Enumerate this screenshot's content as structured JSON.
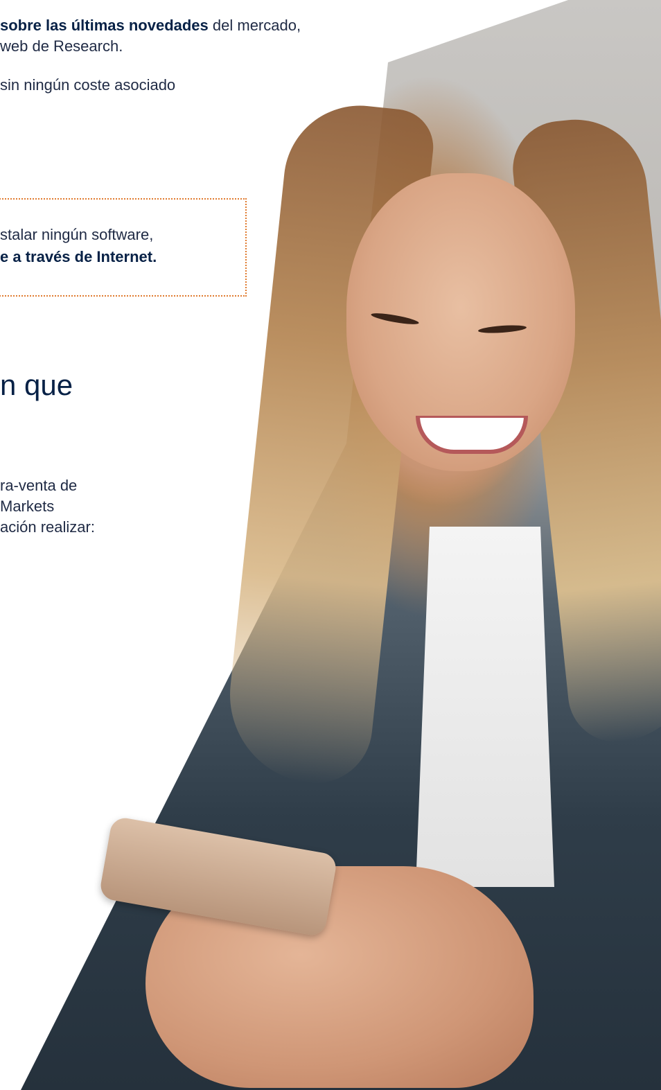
{
  "intro": {
    "line1_prefix": "",
    "line1_bold": "sobre las últimas novedades",
    "line1_suffix": " del mercado,",
    "line2": "web de Research."
  },
  "cost_note": "sin ningún coste asociado",
  "callout": {
    "line1": "stalar ningún software,",
    "line2_bold": "e a través de Internet."
  },
  "heading": "n que",
  "paragraph": {
    "line1": "ra-venta de",
    "line2": "Markets",
    "line3": "ación realizar:"
  },
  "colors": {
    "navy": "#072146",
    "text": "#1f2a44",
    "accent_orange": "#e07a2e",
    "panel_gray": "#e9e9ea"
  }
}
